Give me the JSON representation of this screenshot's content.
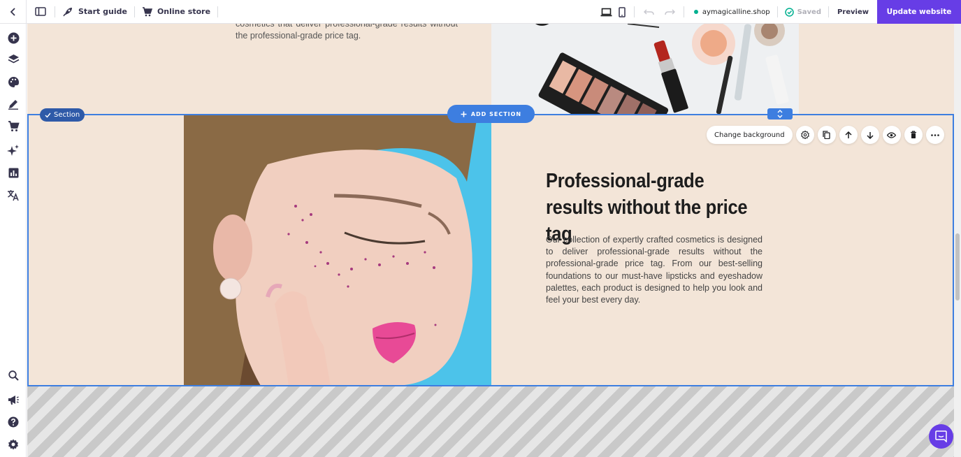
{
  "topbar": {
    "start_guide": "Start guide",
    "online_store": "Online store",
    "domain": "aymagicalline.shop",
    "saved": "Saved",
    "preview": "Preview",
    "update": "Update website"
  },
  "canvas": {
    "top_text": "cosmetics that deliver professional-grade results without the professional-grade price tag.",
    "section_tag": "Section",
    "add_section": "ADD SECTION",
    "change_background": "Change background",
    "heading": "Professional-grade results without the price tag",
    "body": "Our collection of expertly crafted cosmetics is designed to deliver professional-grade results without the professional-grade price tag. From our best-selling foundations to our must-have lipsticks and eyeshadow palettes, each product is designed to help you look and feel your best every day."
  },
  "colors": {
    "accent": "#673de6",
    "selection": "#3d7ee0",
    "section_bg": "#f3e5d8"
  },
  "icons": {
    "sidebar_top": [
      "add-circle-icon",
      "layers-icon",
      "palette-icon",
      "pen-icon",
      "cart-icon",
      "sparkle-icon",
      "chart-icon",
      "translate-icon"
    ],
    "sidebar_bottom": [
      "search-icon",
      "megaphone-icon",
      "help-icon",
      "settings-icon"
    ]
  }
}
